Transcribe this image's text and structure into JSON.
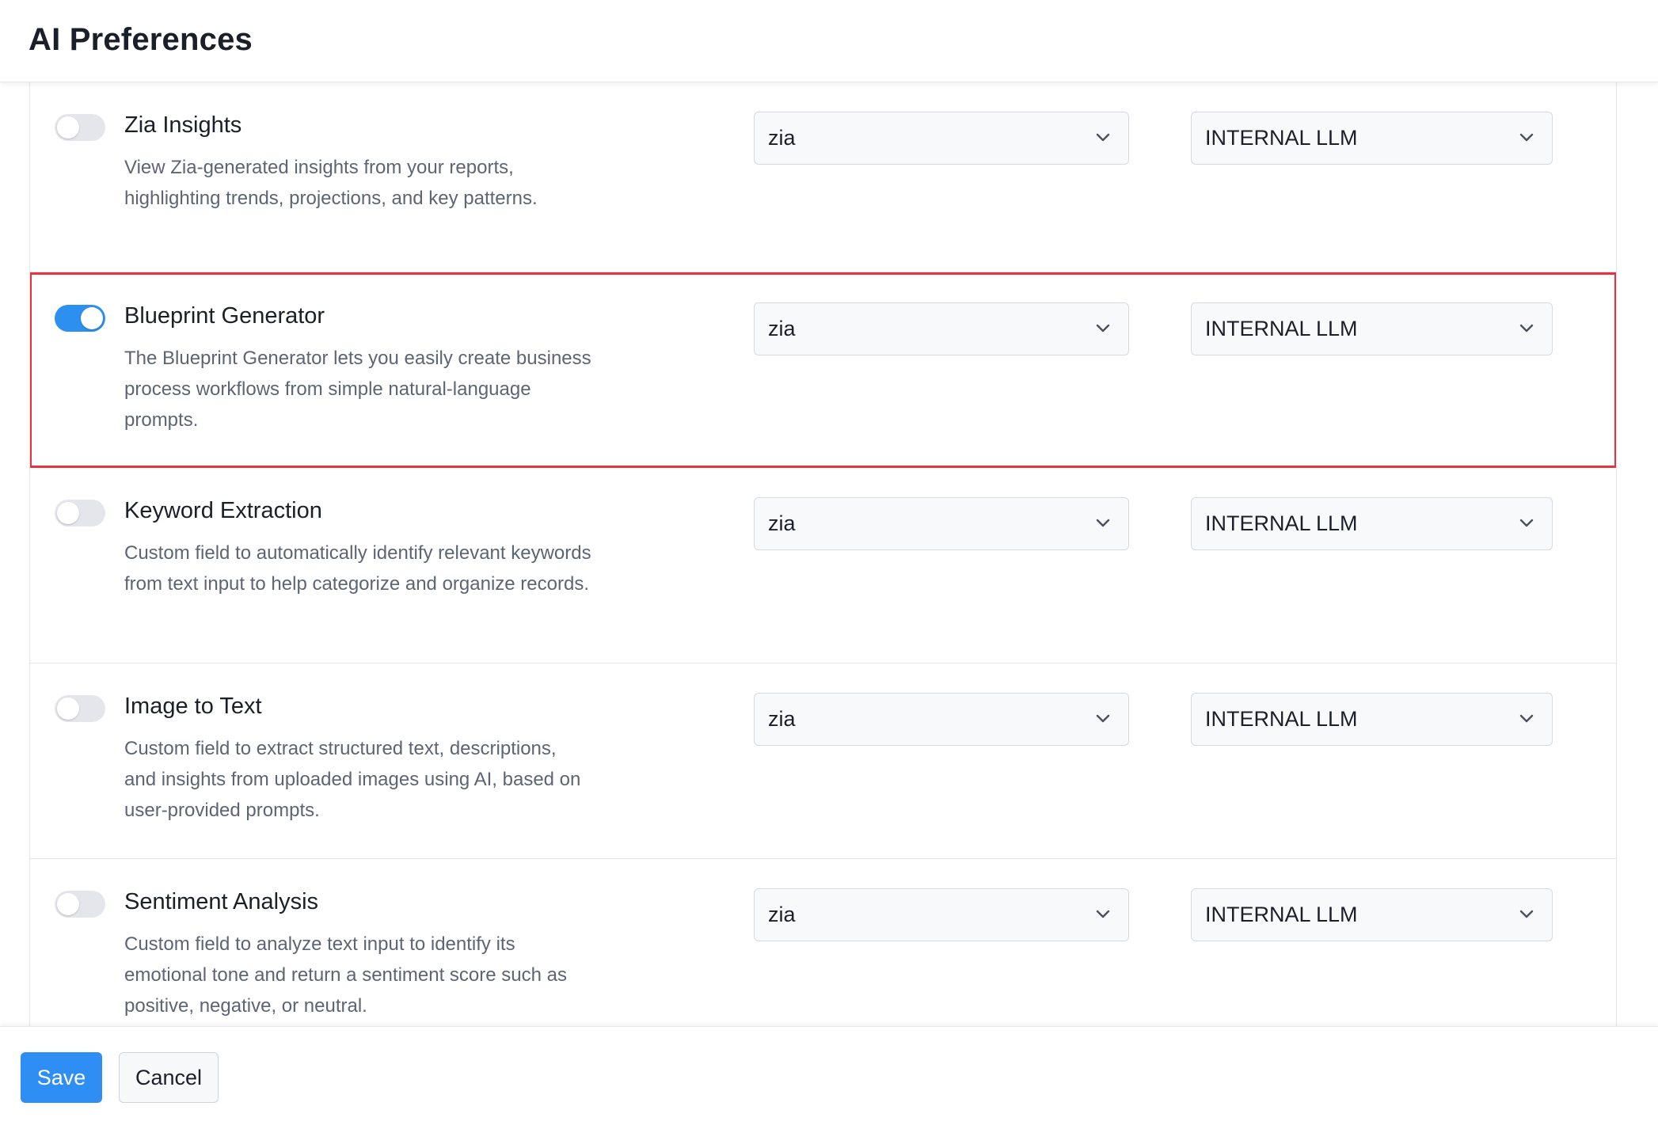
{
  "header": {
    "title": "AI Preferences"
  },
  "features": [
    {
      "name": "Zia Insights",
      "description": "View Zia-generated insights from your reports, highlighting trends, projections, and key patterns.",
      "enabled": false,
      "model": "zia",
      "llm": "INTERNAL LLM"
    },
    {
      "name": "Blueprint Generator",
      "description": "The Blueprint Generator lets you easily create business process workflows from simple natural-language prompts.",
      "enabled": true,
      "model": "zia",
      "llm": "INTERNAL LLM"
    },
    {
      "name": "Keyword Extraction",
      "description": "Custom field to automatically identify relevant keywords from text input to help categorize and organize records.",
      "enabled": false,
      "model": "zia",
      "llm": "INTERNAL LLM"
    },
    {
      "name": "Image to Text",
      "description": "Custom field to extract structured text, descriptions, and insights from uploaded images using AI, based on user-provided prompts.",
      "enabled": false,
      "model": "zia",
      "llm": "INTERNAL LLM"
    },
    {
      "name": "Sentiment Analysis",
      "description": "Custom field to analyze text input to identify its emotional tone and return a sentiment score such as positive, negative, or neutral.",
      "enabled": false,
      "model": "zia",
      "llm": "INTERNAL LLM"
    }
  ],
  "footer": {
    "save_label": "Save",
    "cancel_label": "Cancel"
  },
  "colors": {
    "accent": "#2f8ef3",
    "highlight_border": "#e5343d",
    "toggle_off": "#e4e6eb"
  },
  "icons": {
    "select_arrow": "chevron-down-icon"
  }
}
